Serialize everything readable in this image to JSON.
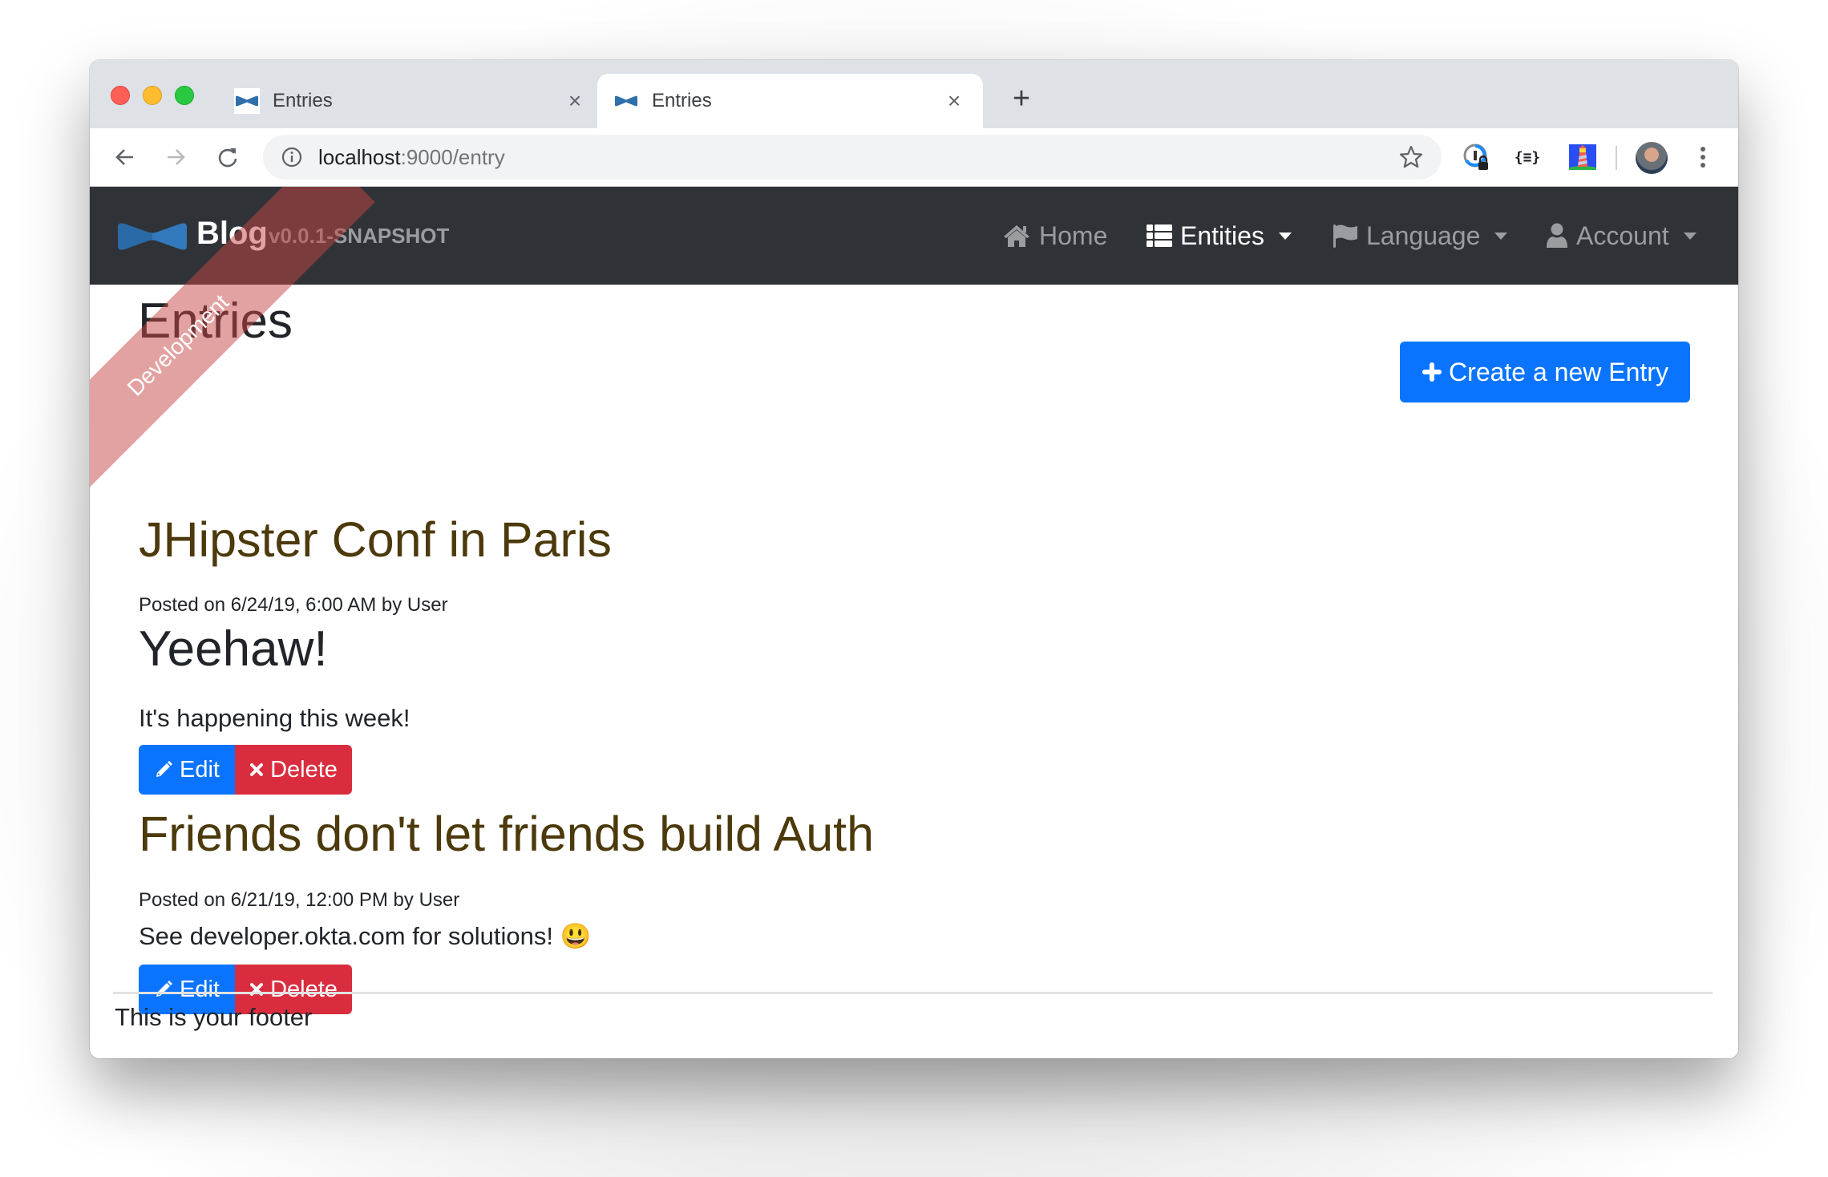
{
  "browser": {
    "tabs": [
      {
        "title": "Entries",
        "active": false
      },
      {
        "title": "Entries",
        "active": true
      }
    ],
    "new_tab_label": "+",
    "close_glyph": "×",
    "url_host": "localhost",
    "url_rest": ":9000/entry",
    "toolbar_icons": [
      "back-icon",
      "forward-icon",
      "reload-icon",
      "info-icon",
      "star-icon",
      "password-manager-extension-icon",
      "json-formatter-extension-icon",
      "lighthouse-extension-icon",
      "profile-avatar",
      "more-menu-icon"
    ]
  },
  "navbar": {
    "brand": "Blog",
    "version": "v0.0.1-SNAPSHOT",
    "ribbon": "Development",
    "items": [
      {
        "label": "Home",
        "icon": "home-icon",
        "active": false,
        "dropdown": false
      },
      {
        "label": "Entities",
        "icon": "list-icon",
        "active": true,
        "dropdown": true
      },
      {
        "label": "Language",
        "icon": "flag-icon",
        "active": false,
        "dropdown": true
      },
      {
        "label": "Account",
        "icon": "user-icon",
        "active": false,
        "dropdown": true
      }
    ]
  },
  "main": {
    "title": "Entries",
    "create_button": "Create a new Entry",
    "entries": [
      {
        "title": "JHipster Conf in Paris",
        "meta": "Posted on 6/24/19, 6:00 AM by User",
        "subtitle": "Yeehaw!",
        "body": "It's happening this week!",
        "edit_label": "Edit",
        "delete_label": "Delete"
      },
      {
        "title": "Friends don't let friends build Auth",
        "meta": "Posted on 6/21/19, 12:00 PM by User",
        "body": "See developer.okta.com for solutions! 😃",
        "edit_label": "Edit",
        "delete_label": "Delete"
      }
    ]
  },
  "footer": {
    "text": "This is your footer"
  },
  "colors": {
    "navbar_bg": "#2f3337",
    "primary": "#0a74ff",
    "danger": "#d92d3f",
    "entry_title": "#4c3a0c",
    "ribbon": "#c84646"
  }
}
